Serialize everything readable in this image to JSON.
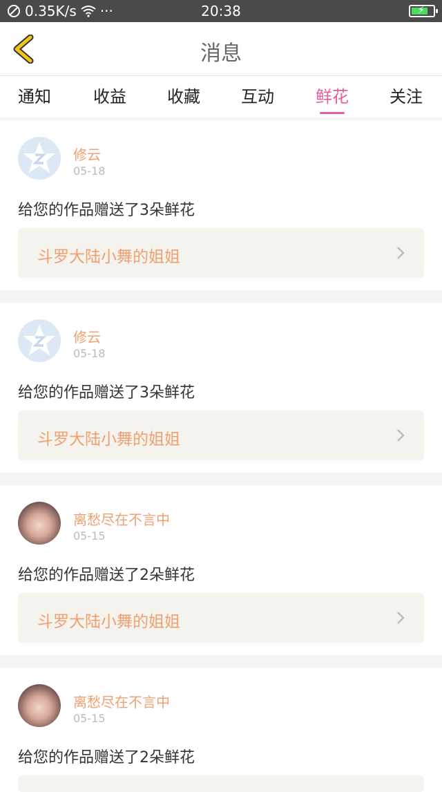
{
  "status_bar": {
    "network_speed": "0.35K/s",
    "dots": "···",
    "time": "20:38",
    "battery_level": 0.75
  },
  "header": {
    "title": "消息",
    "back_icon": "chevron-left-icon"
  },
  "tabs": [
    {
      "label": "通知",
      "active": false
    },
    {
      "label": "收益",
      "active": false
    },
    {
      "label": "收藏",
      "active": false
    },
    {
      "label": "互动",
      "active": false
    },
    {
      "label": "鲜花",
      "active": true
    },
    {
      "label": "关注",
      "active": false
    }
  ],
  "messages": [
    {
      "user": "修云",
      "date": "05-18",
      "text": "给您的作品赠送了3朵鲜花",
      "work": "斗罗大陆小舞的姐姐",
      "avatar": "qq-default-avatar"
    },
    {
      "user": "修云",
      "date": "05-18",
      "text": "给您的作品赠送了3朵鲜花",
      "work": "斗罗大陆小舞的姐姐",
      "avatar": "qq-default-avatar"
    },
    {
      "user": "离愁尽在不言中",
      "date": "05-15",
      "text": "给您的作品赠送了2朵鲜花",
      "work": "斗罗大陆小舞的姐姐",
      "avatar": "user-photo-avatar"
    },
    {
      "user": "离愁尽在不言中",
      "date": "05-15",
      "text": "给您的作品赠送了2朵鲜花",
      "work": "",
      "avatar": "user-photo-avatar"
    }
  ],
  "colors": {
    "accent": "#e85d9a",
    "username": "#f0a070",
    "back_icon": "#f0c419"
  }
}
